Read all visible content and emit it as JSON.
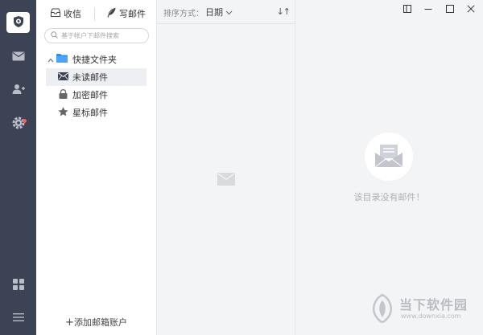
{
  "rail": {
    "icons": [
      "shield-logo",
      "mail-icon",
      "contacts-icon",
      "settings-icon",
      "apps-grid-icon",
      "menu-icon"
    ]
  },
  "toolbar": {
    "receive_label": "收信",
    "compose_label": "写邮件"
  },
  "search": {
    "placeholder": "基于帐户下邮件搜索"
  },
  "folders": {
    "group_label": "快捷文件夹",
    "items": [
      {
        "label": "未读邮件",
        "icon": "envelope-icon",
        "selected": true
      },
      {
        "label": "加密邮件",
        "icon": "lock-icon",
        "selected": false
      },
      {
        "label": "星标邮件",
        "icon": "star-icon",
        "selected": false
      }
    ],
    "add_account_label": "添加邮箱账户",
    "add_account_plus": "+"
  },
  "list": {
    "sort_label": "排序方式：",
    "sort_value": "日期",
    "sort_dir": "↓↑"
  },
  "reader": {
    "empty_text": "该目录没有邮件！"
  },
  "watermark": {
    "title": "当下软件园",
    "url": "www.downxia.com"
  },
  "colors": {
    "rail_bg": "#3c4355",
    "accent_blue": "#2f8cf0",
    "badge_red": "#f06262",
    "pane_bg": "#f3f4f6"
  }
}
